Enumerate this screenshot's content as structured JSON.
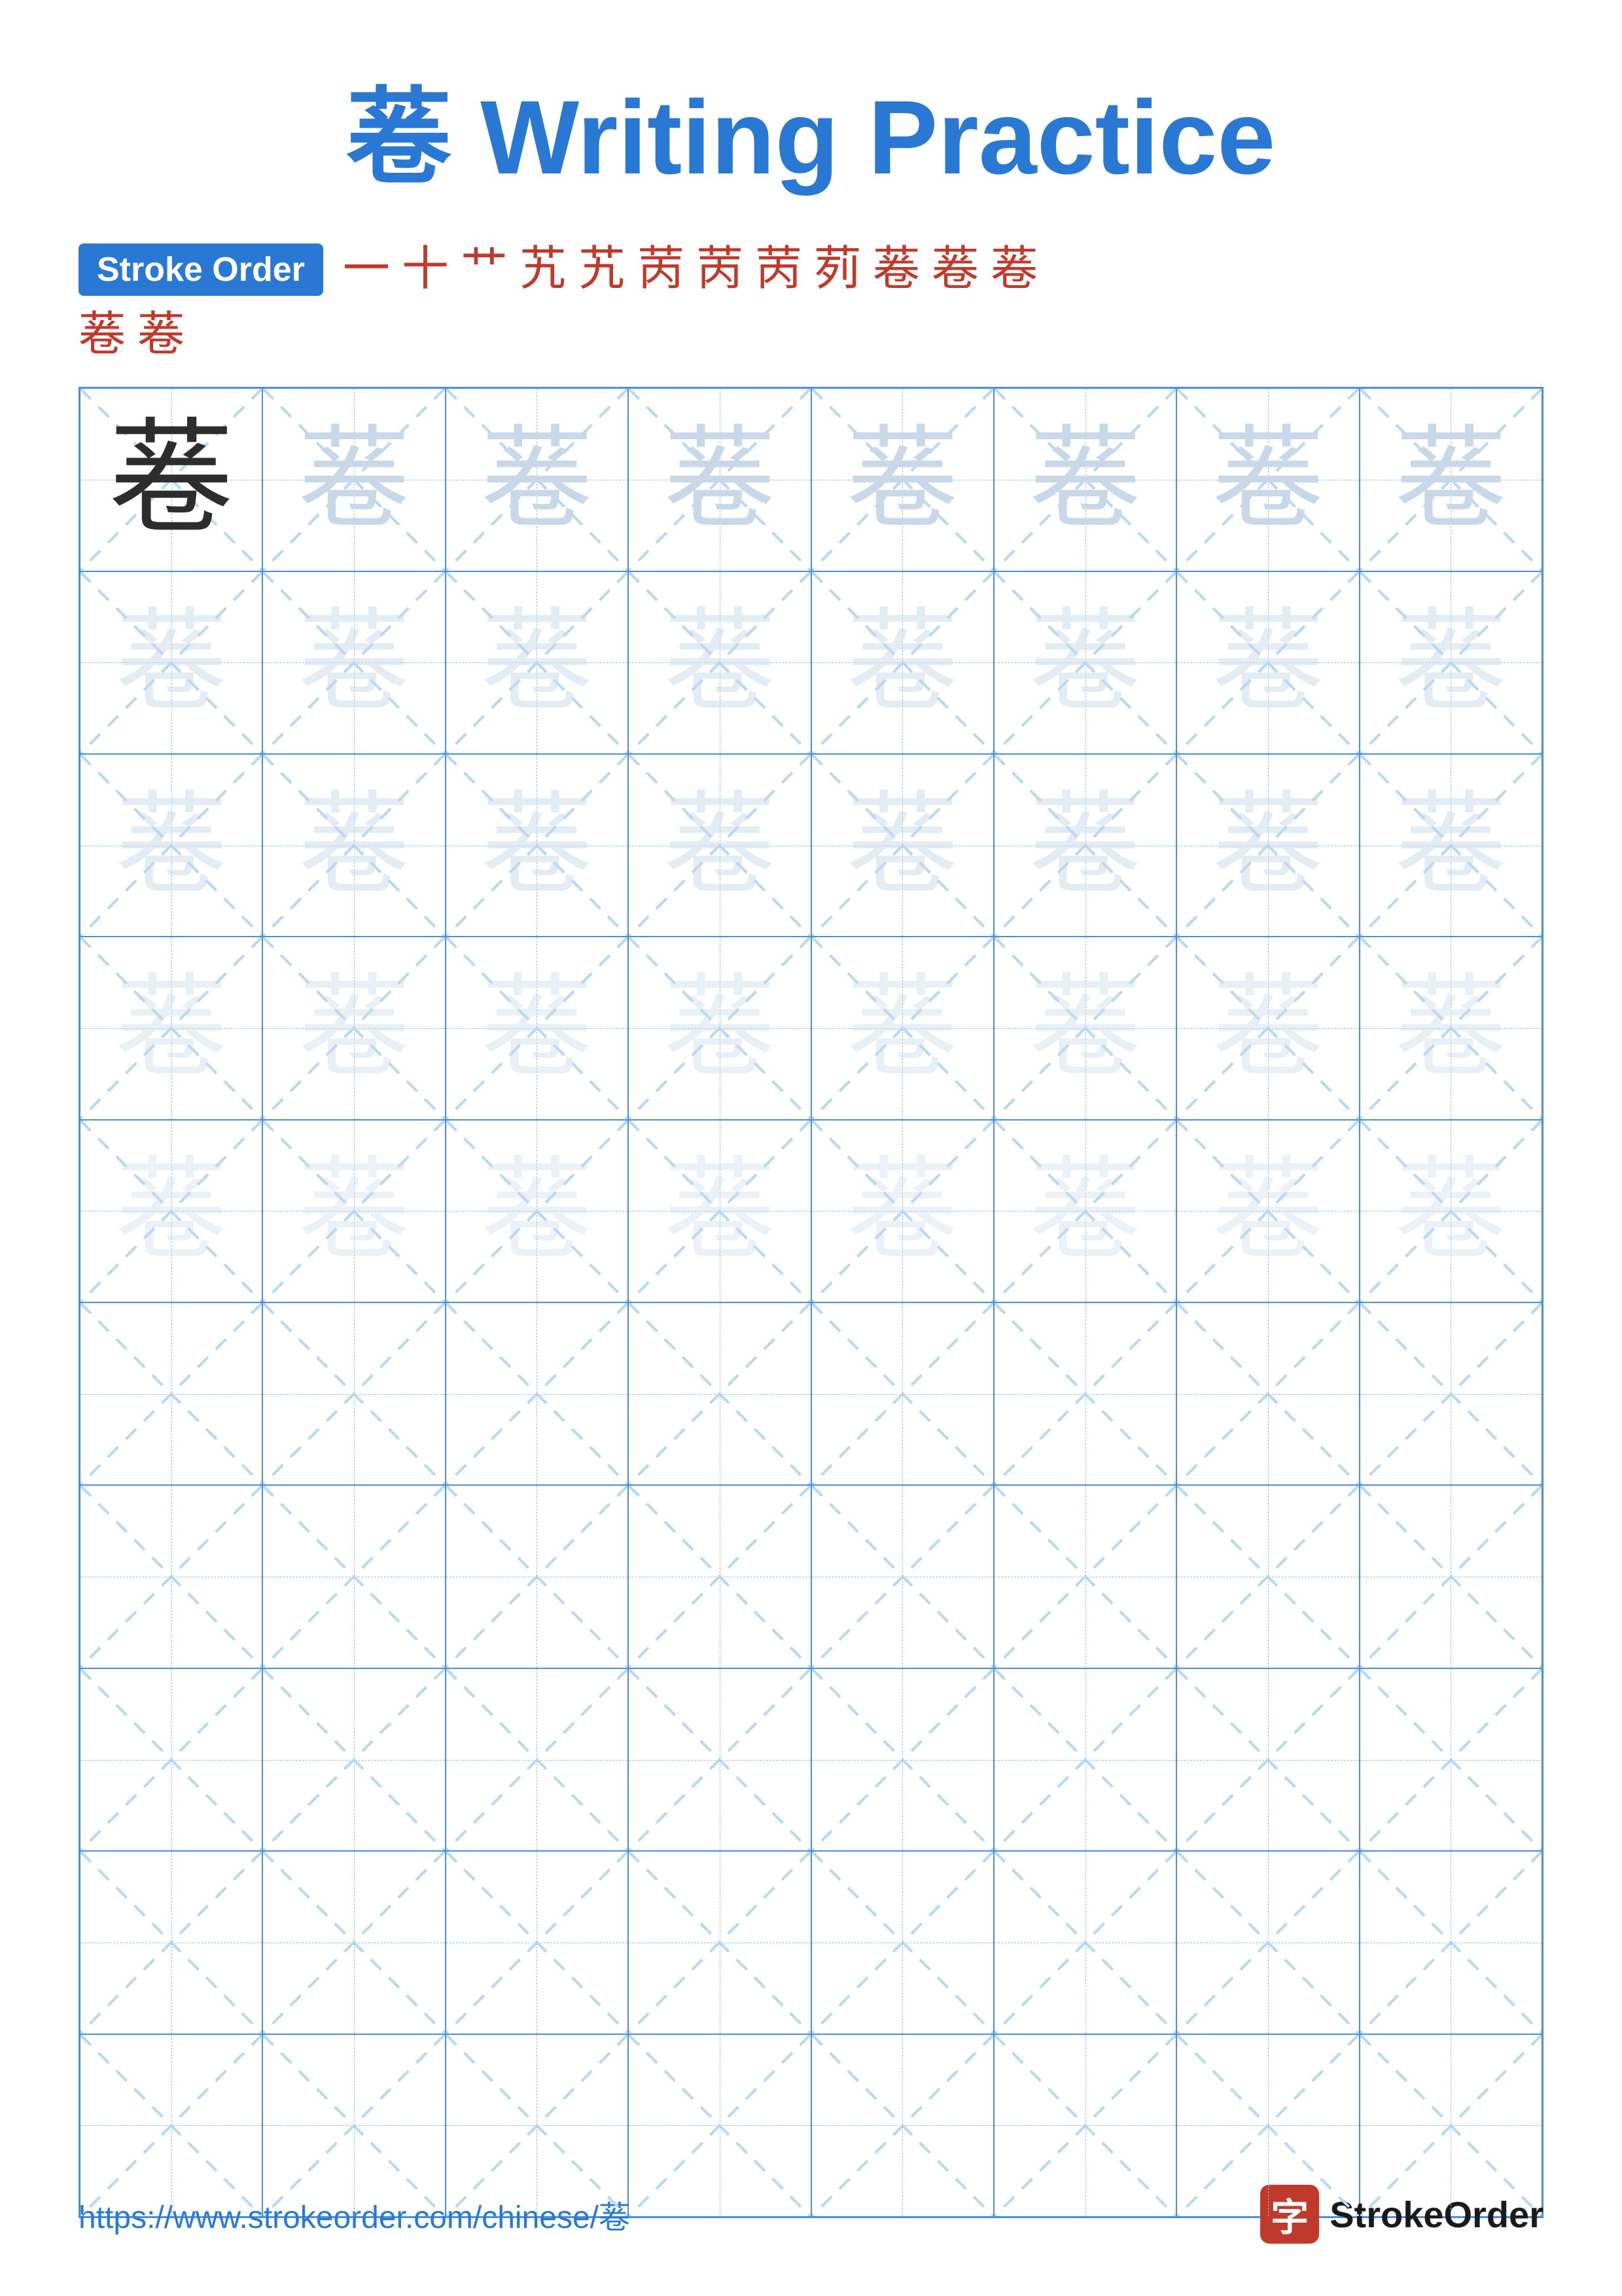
{
  "title": "菤 Writing Practice",
  "stroke_order": {
    "badge_label": "Stroke Order",
    "strokes_line1": [
      "一",
      "十",
      "艹",
      "艽",
      "艽",
      "苪",
      "苪",
      "苪",
      "茢",
      "菤",
      "菤",
      "菤"
    ],
    "strokes_line2": [
      "菤",
      "菤"
    ]
  },
  "character": "菤",
  "grid": {
    "rows": 10,
    "cols": 8,
    "filled_rows": 5,
    "empty_rows": 5
  },
  "footer": {
    "url": "https://www.strokeorder.com/chinese/菤",
    "brand_char": "字",
    "brand_name": "StrokeOrder"
  }
}
